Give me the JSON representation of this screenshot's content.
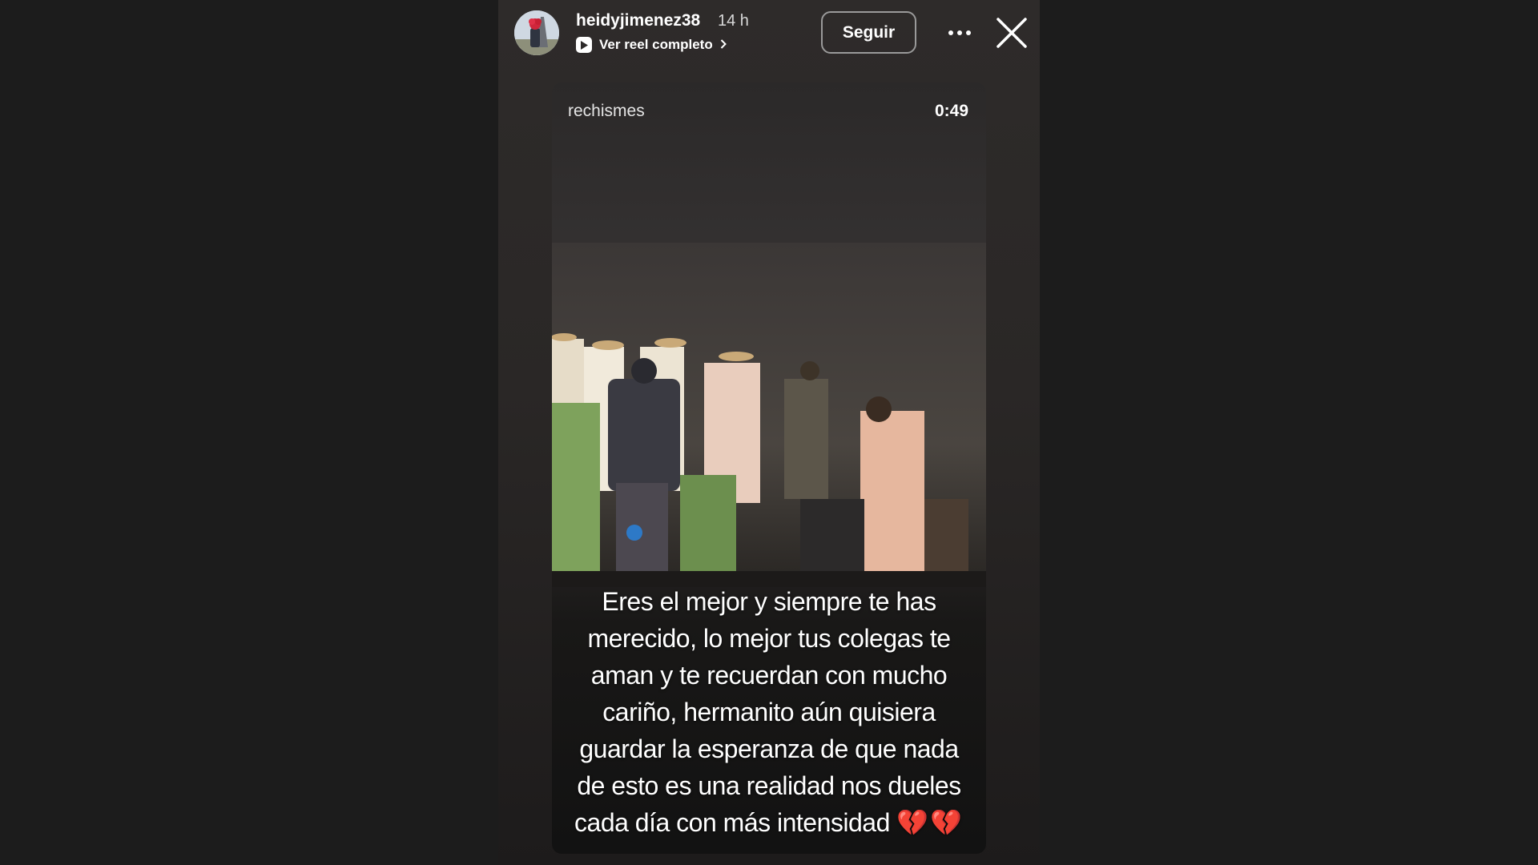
{
  "header": {
    "username": "heidyjimenez38",
    "time_ago": "14 h",
    "reel_link_label": "Ver reel completo",
    "follow_label": "Seguir"
  },
  "reel": {
    "source_username": "rechismes",
    "duration": "0:49",
    "caption": "Eres el mejor y siempre te has merecido, lo mejor tus colegas te aman y te recuerdan con mucho cariño, hermanito aún quisiera guardar la esperanza de que nada de esto es una realidad nos dueles cada día con más intensidad",
    "caption_emoji": "💔💔"
  },
  "icons": {
    "play": "play-icon",
    "chevron": "chevron-right-icon",
    "more": "more-options-icon",
    "close": "close-icon"
  },
  "colors": {
    "background": "#1c1c1c",
    "story_panel": "#2e2b2a",
    "heart": "#e0455a"
  }
}
